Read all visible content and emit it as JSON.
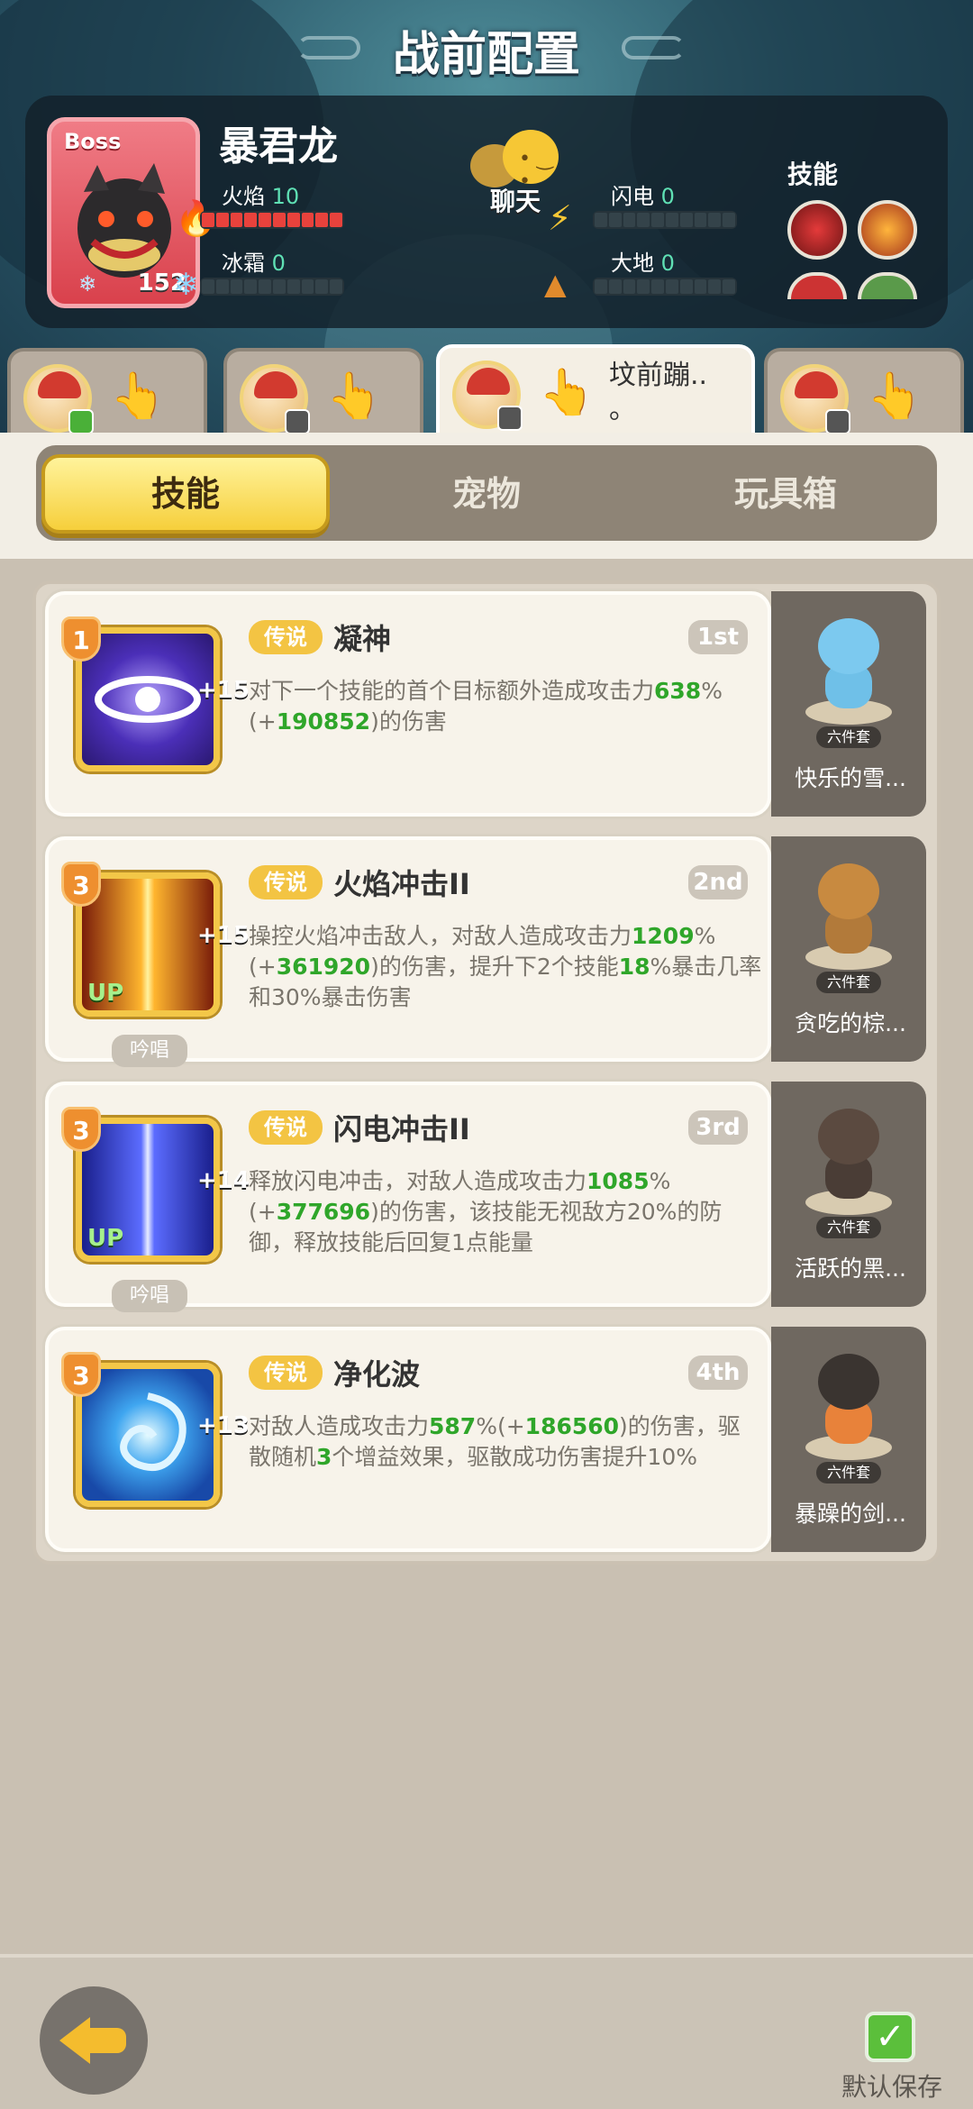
{
  "header": {
    "title": "战前配置",
    "boss": {
      "tag": "Boss",
      "level": "152",
      "name": "暴君龙",
      "stats": {
        "fire": {
          "label": "火焰",
          "value": "10"
        },
        "ice": {
          "label": "冰霜",
          "value": "0"
        },
        "lightning": {
          "label": "闪电",
          "value": "0"
        },
        "earth": {
          "label": "大地",
          "value": "0"
        }
      }
    },
    "chat_label": "聊天",
    "skills_label": "技能"
  },
  "hero_tabs": [
    {
      "label": ""
    },
    {
      "label": ""
    },
    {
      "label": "坟前蹦.."
    },
    {
      "label": ""
    }
  ],
  "hero_tab_active_suffix": "。",
  "tabs": {
    "skills": "技能",
    "pets": "宠物",
    "toybox": "玩具箱"
  },
  "skills": [
    {
      "star": "1",
      "plus": "+15",
      "rarity": "传说",
      "name": "凝神",
      "order": "1st",
      "desc": [
        "对下一个技能的首个目标额外造成攻击力",
        "638",
        "%(+",
        "190852",
        ")的伤害"
      ],
      "chant": "",
      "pet_name": "快乐的雪...",
      "pet_set": "六件套"
    },
    {
      "star": "3",
      "plus": "+15",
      "rarity": "传说",
      "name": "火焰冲击II",
      "order": "2nd",
      "desc": [
        "操控火焰冲击敌人，对敌人造成攻击力",
        "1209",
        "%(+",
        "361920",
        ")的伤害，提升下2个技能",
        "18",
        "%暴击几率和30%暴击伤害"
      ],
      "chant": "吟唱",
      "up": "UP",
      "pet_name": "贪吃的棕...",
      "pet_set": "六件套"
    },
    {
      "star": "3",
      "plus": "+14",
      "rarity": "传说",
      "name": "闪电冲击II",
      "order": "3rd",
      "desc": [
        "释放闪电冲击，对敌人造成攻击力",
        "1085",
        "%(+",
        "377696",
        ")的伤害，该技能无视敌方20%的防御，释放技能后回复1点能量"
      ],
      "chant": "吟唱",
      "up": "UP",
      "pet_name": "活跃的黑...",
      "pet_set": "六件套"
    },
    {
      "star": "3",
      "plus": "+13",
      "rarity": "传说",
      "name": "净化波",
      "order": "4th",
      "desc": [
        "对敌人造成攻击力",
        "587",
        "%(+",
        "186560",
        ")的伤害，驱散随机",
        "3",
        "个增益效果，驱散成功伤害提升10%"
      ],
      "chant": "",
      "pet_name": "暴躁的剑...",
      "pet_set": "六件套"
    }
  ],
  "bottom": {
    "save_label": "默认保存"
  },
  "colors": {
    "accent_yellow": "#f6cf3b",
    "green_value": "#2fa62a",
    "fire_bar": "#e8423c"
  },
  "icons": {
    "fire": "fire-icon",
    "ice": "snowflake-icon",
    "lightning": "lightning-icon",
    "earth": "earth-icon",
    "back": "back-arrow-icon",
    "save": "checkmark-icon"
  }
}
